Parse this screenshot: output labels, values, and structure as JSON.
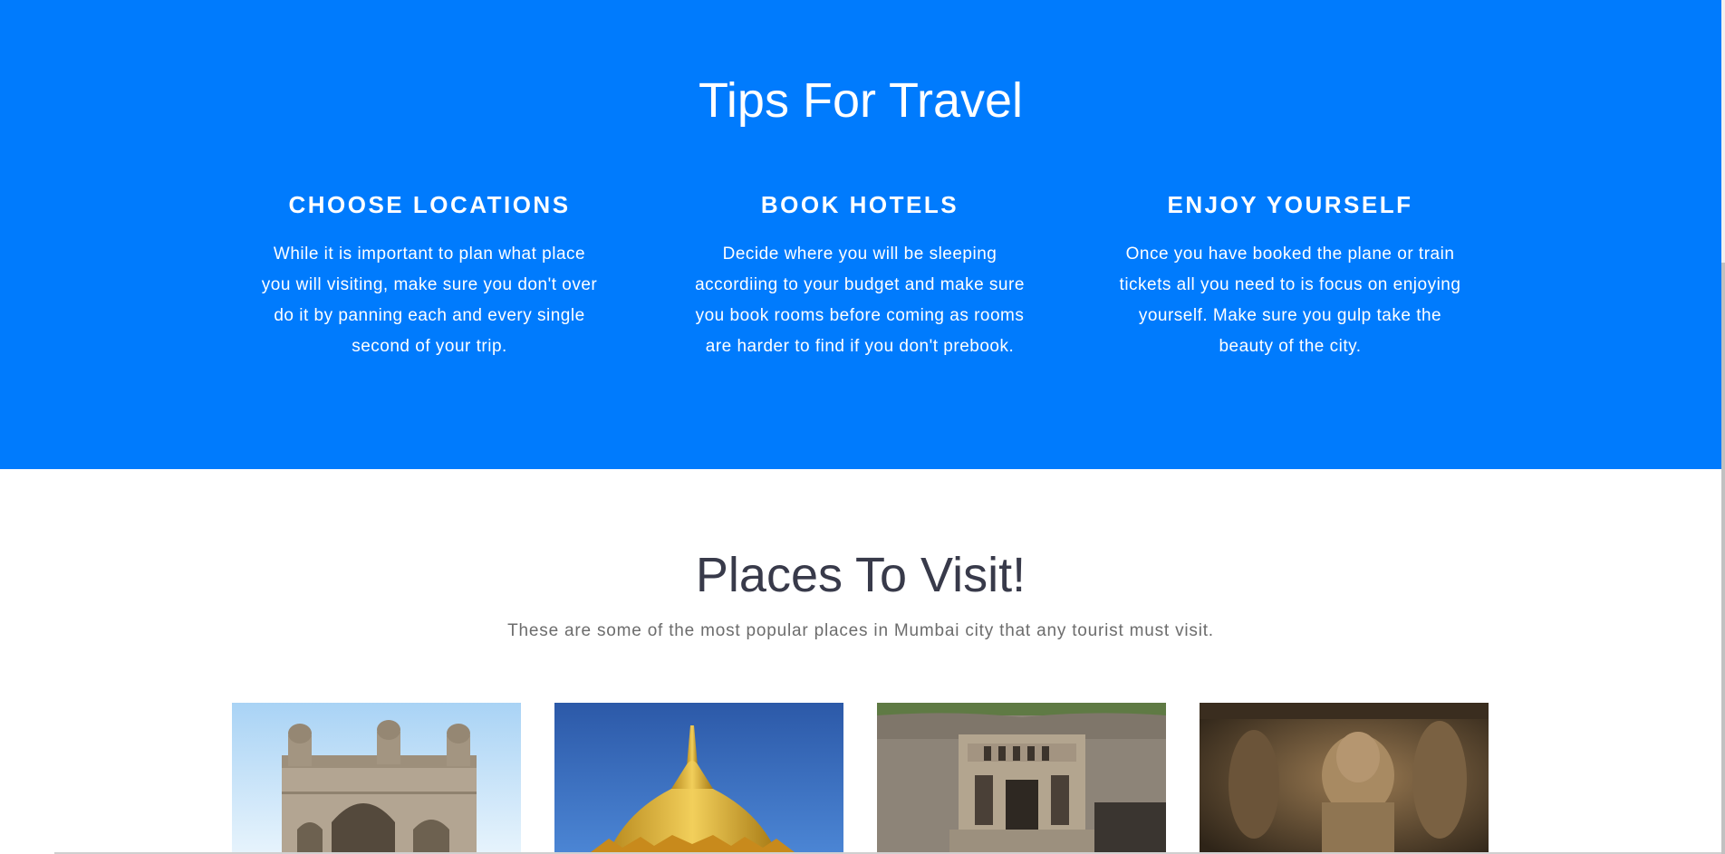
{
  "tips": {
    "title": "Tips For Travel",
    "background_color": "#007bfd",
    "items": [
      {
        "heading": "CHOOSE LOCATIONS",
        "text": "While it is important to plan what place you will visiting, make sure you don't over do it by panning each and every single second of your trip."
      },
      {
        "heading": "BOOK HOTELS",
        "text": "Decide where you will be sleeping accordiing to your budget and make sure you book rooms before coming as rooms are harder to find if you don't prebook."
      },
      {
        "heading": "ENJOY YOURSELF",
        "text": "Once you have booked the plane or train tickets all you need to is focus on enjoying yourself. Make sure you gulp take the beauty of the city."
      }
    ]
  },
  "places": {
    "title": "Places To Visit!",
    "subtitle": "These are some of the most popular places in Mumbai city that any tourist must visit.",
    "cards": [
      {
        "image": "archway-monument-photo"
      },
      {
        "image": "golden-pagoda-photo"
      },
      {
        "image": "rock-cut-cave-photo"
      },
      {
        "image": "cave-sculpture-photo"
      }
    ]
  }
}
